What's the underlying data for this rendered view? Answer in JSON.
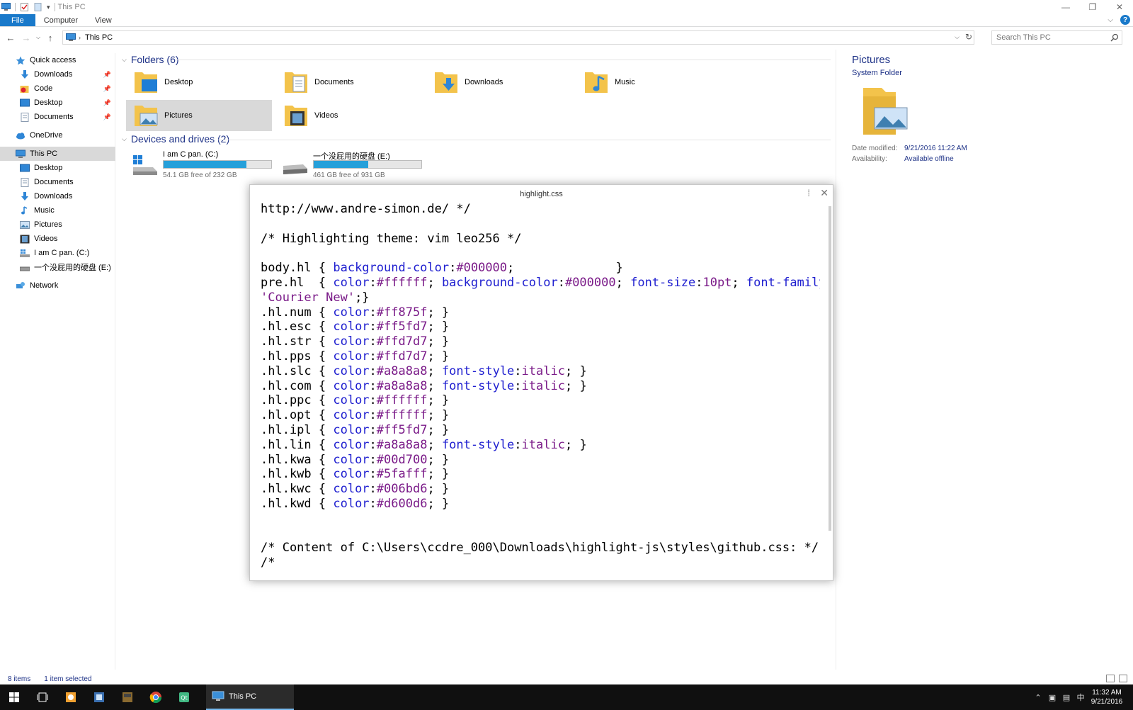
{
  "window": {
    "title": "This PC"
  },
  "ribbon": {
    "tabs": [
      "File",
      "Computer",
      "View"
    ]
  },
  "address": {
    "path": "This PC",
    "search_placeholder": "Search This PC"
  },
  "nav": {
    "items": [
      {
        "label": "Quick access",
        "icon": "star-icon",
        "pinned": false
      },
      {
        "label": "Downloads",
        "icon": "download-arrow-icon",
        "pinned": true
      },
      {
        "label": "Code",
        "icon": "code-folder-icon",
        "pinned": true
      },
      {
        "label": "Desktop",
        "icon": "desktop-icon",
        "pinned": true
      },
      {
        "label": "Documents",
        "icon": "documents-icon",
        "pinned": true
      },
      {
        "label": "OneDrive",
        "icon": "cloud-icon",
        "pinned": false
      },
      {
        "label": "This PC",
        "icon": "computer-icon",
        "pinned": false
      },
      {
        "label": "Desktop",
        "icon": "desktop-icon",
        "pinned": false
      },
      {
        "label": "Documents",
        "icon": "documents-icon",
        "pinned": false
      },
      {
        "label": "Downloads",
        "icon": "download-arrow-icon",
        "pinned": false
      },
      {
        "label": "Music",
        "icon": "music-note-icon",
        "pinned": false
      },
      {
        "label": "Pictures",
        "icon": "pictures-icon",
        "pinned": false
      },
      {
        "label": "Videos",
        "icon": "film-icon",
        "pinned": false
      },
      {
        "label": "I am C pan. (C:)",
        "icon": "windows-drive-icon",
        "pinned": false
      },
      {
        "label": "一个没屁用的硬盘 (E:)",
        "icon": "drive-icon",
        "pinned": false
      },
      {
        "label": "Network",
        "icon": "network-icon",
        "pinned": false
      }
    ]
  },
  "folders": {
    "header": "Folders (6)",
    "items": [
      "Desktop",
      "Documents",
      "Downloads",
      "Music",
      "Pictures",
      "Videos"
    ]
  },
  "drives": {
    "header": "Devices and drives (2)",
    "items": [
      {
        "name": "I am C pan. (C:)",
        "free": "54.1 GB free of 232 GB",
        "used_fraction": 0.767
      },
      {
        "name": "一个没屁用的硬盘 (E:)",
        "free": "461 GB free of 931 GB",
        "used_fraction": 0.505
      }
    ]
  },
  "details": {
    "title": "Pictures",
    "subtitle": "System Folder",
    "date_label": "Date modified:",
    "date_value": "9/21/2016 11:22 AM",
    "avail_label": "Availability:",
    "avail_value": "Available offline"
  },
  "status": {
    "items": "8 items",
    "selected": "1 item selected"
  },
  "taskbar": {
    "app_label": "This PC",
    "time": "11:32 AM",
    "date": "9/21/2016",
    "ime": "中"
  },
  "editor": {
    "title": "highlight.css",
    "lines": [
      [
        [
          "t-sel",
          "http://www.andre-simon.de/ */"
        ]
      ],
      [],
      [
        [
          "t-sel",
          "/* Highlighting theme: vim leo256 */"
        ]
      ],
      [],
      [
        [
          "t-sel",
          "body.hl { "
        ],
        [
          "t-prop",
          "background-color"
        ],
        [
          "t-sel",
          ":"
        ],
        [
          "t-val",
          "#000000"
        ],
        [
          "t-sel",
          ";              }"
        ]
      ],
      [
        [
          "t-sel",
          "pre.hl  { "
        ],
        [
          "t-prop",
          "color"
        ],
        [
          "t-sel",
          ":"
        ],
        [
          "t-val",
          "#ffffff"
        ],
        [
          "t-sel",
          "; "
        ],
        [
          "t-prop",
          "background-color"
        ],
        [
          "t-sel",
          ":"
        ],
        [
          "t-val",
          "#000000"
        ],
        [
          "t-sel",
          "; "
        ],
        [
          "t-prop",
          "font-size"
        ],
        [
          "t-sel",
          ":"
        ],
        [
          "t-val",
          "10pt"
        ],
        [
          "t-sel",
          "; "
        ],
        [
          "t-prop",
          "font-family"
        ],
        [
          "t-sel",
          ":"
        ]
      ],
      [
        [
          "t-str",
          "'Courier New'"
        ],
        [
          "t-sel",
          ";}"
        ]
      ],
      [
        [
          "t-sel",
          ".hl.num { "
        ],
        [
          "t-prop",
          "color"
        ],
        [
          "t-sel",
          ":"
        ],
        [
          "t-val",
          "#ff875f"
        ],
        [
          "t-sel",
          "; }"
        ]
      ],
      [
        [
          "t-sel",
          ".hl.esc { "
        ],
        [
          "t-prop",
          "color"
        ],
        [
          "t-sel",
          ":"
        ],
        [
          "t-val",
          "#ff5fd7"
        ],
        [
          "t-sel",
          "; }"
        ]
      ],
      [
        [
          "t-sel",
          ".hl.str { "
        ],
        [
          "t-prop",
          "color"
        ],
        [
          "t-sel",
          ":"
        ],
        [
          "t-val",
          "#ffd7d7"
        ],
        [
          "t-sel",
          "; }"
        ]
      ],
      [
        [
          "t-sel",
          ".hl.pps { "
        ],
        [
          "t-prop",
          "color"
        ],
        [
          "t-sel",
          ":"
        ],
        [
          "t-val",
          "#ffd7d7"
        ],
        [
          "t-sel",
          "; }"
        ]
      ],
      [
        [
          "t-sel",
          ".hl.slc { "
        ],
        [
          "t-prop",
          "color"
        ],
        [
          "t-sel",
          ":"
        ],
        [
          "t-val",
          "#a8a8a8"
        ],
        [
          "t-sel",
          "; "
        ],
        [
          "t-prop",
          "font-style"
        ],
        [
          "t-sel",
          ":"
        ],
        [
          "t-val",
          "italic"
        ],
        [
          "t-sel",
          "; }"
        ]
      ],
      [
        [
          "t-sel",
          ".hl.com { "
        ],
        [
          "t-prop",
          "color"
        ],
        [
          "t-sel",
          ":"
        ],
        [
          "t-val",
          "#a8a8a8"
        ],
        [
          "t-sel",
          "; "
        ],
        [
          "t-prop",
          "font-style"
        ],
        [
          "t-sel",
          ":"
        ],
        [
          "t-val",
          "italic"
        ],
        [
          "t-sel",
          "; }"
        ]
      ],
      [
        [
          "t-sel",
          ".hl.ppc { "
        ],
        [
          "t-prop",
          "color"
        ],
        [
          "t-sel",
          ":"
        ],
        [
          "t-val",
          "#ffffff"
        ],
        [
          "t-sel",
          "; }"
        ]
      ],
      [
        [
          "t-sel",
          ".hl.opt { "
        ],
        [
          "t-prop",
          "color"
        ],
        [
          "t-sel",
          ":"
        ],
        [
          "t-val",
          "#ffffff"
        ],
        [
          "t-sel",
          "; }"
        ]
      ],
      [
        [
          "t-sel",
          ".hl.ipl { "
        ],
        [
          "t-prop",
          "color"
        ],
        [
          "t-sel",
          ":"
        ],
        [
          "t-val",
          "#ff5fd7"
        ],
        [
          "t-sel",
          "; }"
        ]
      ],
      [
        [
          "t-sel",
          ".hl.lin { "
        ],
        [
          "t-prop",
          "color"
        ],
        [
          "t-sel",
          ":"
        ],
        [
          "t-val",
          "#a8a8a8"
        ],
        [
          "t-sel",
          "; "
        ],
        [
          "t-prop",
          "font-style"
        ],
        [
          "t-sel",
          ":"
        ],
        [
          "t-val",
          "italic"
        ],
        [
          "t-sel",
          "; }"
        ]
      ],
      [
        [
          "t-sel",
          ".hl.kwa { "
        ],
        [
          "t-prop",
          "color"
        ],
        [
          "t-sel",
          ":"
        ],
        [
          "t-val",
          "#00d700"
        ],
        [
          "t-sel",
          "; }"
        ]
      ],
      [
        [
          "t-sel",
          ".hl.kwb { "
        ],
        [
          "t-prop",
          "color"
        ],
        [
          "t-sel",
          ":"
        ],
        [
          "t-val",
          "#5fafff"
        ],
        [
          "t-sel",
          "; }"
        ]
      ],
      [
        [
          "t-sel",
          ".hl.kwc { "
        ],
        [
          "t-prop",
          "color"
        ],
        [
          "t-sel",
          ":"
        ],
        [
          "t-val",
          "#006bd6"
        ],
        [
          "t-sel",
          "; }"
        ]
      ],
      [
        [
          "t-sel",
          ".hl.kwd { "
        ],
        [
          "t-prop",
          "color"
        ],
        [
          "t-sel",
          ":"
        ],
        [
          "t-val",
          "#d600d6"
        ],
        [
          "t-sel",
          "; }"
        ]
      ],
      [],
      [],
      [
        [
          "t-sel",
          "/* Content of C:\\Users\\ccdre_000\\Downloads\\highlight-js\\styles\\github.css: */"
        ]
      ],
      [
        [
          "t-sel",
          "/*"
        ]
      ]
    ]
  }
}
